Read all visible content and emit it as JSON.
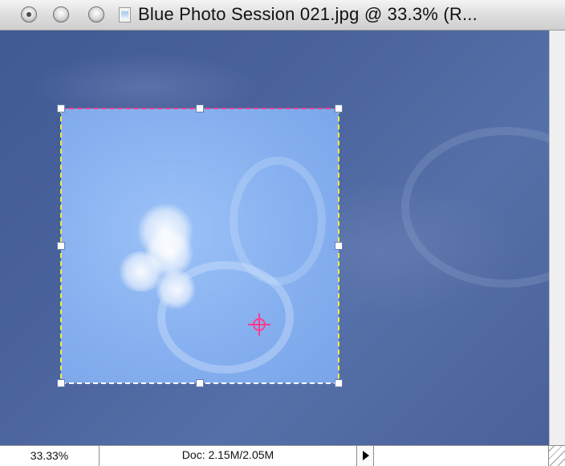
{
  "window": {
    "title": "Blue Photo Session 021.jpg @ 33.3% (R...",
    "buttons": [
      "close",
      "minimize",
      "zoom"
    ],
    "proxy_icon": "document-icon"
  },
  "statusbar": {
    "zoom": "33.33%",
    "doc_info": "Doc: 2.15M/2.05M"
  },
  "colors": {
    "sky_dark": "#405a94",
    "selection_fill": "#86b0ef",
    "marquee_pink": "#ff3c8c",
    "marquee_yellow": "#f5e94a",
    "crosshair": "#ff3c8c"
  }
}
